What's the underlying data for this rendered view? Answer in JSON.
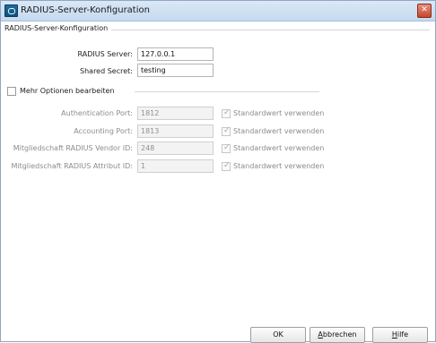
{
  "window": {
    "title": "RADIUS-Server-Konfiguration"
  },
  "group": {
    "label": "RADIUS-Server-Konfiguration"
  },
  "server": {
    "label": "RADIUS Server:",
    "value": "127.0.0.1"
  },
  "secret": {
    "label": "Shared Secret:",
    "value": "testing"
  },
  "more_options": {
    "label": "Mehr Optionen bearbeiten",
    "checked": false
  },
  "advanced": [
    {
      "label": "Authentication Port:",
      "value": "1812",
      "default_label": "Standardwert verwenden",
      "default_checked": true
    },
    {
      "label": "Accounting Port:",
      "value": "1813",
      "default_label": "Standardwert verwenden",
      "default_checked": true
    },
    {
      "label": "Mitgliedschaft RADIUS Vendor ID:",
      "value": "248",
      "default_label": "Standardwert verwenden",
      "default_checked": true
    },
    {
      "label": "Mitgliedschaft RADIUS Attribut ID:",
      "value": "1",
      "default_label": "Standardwert verwenden",
      "default_checked": true
    }
  ],
  "buttons": {
    "ok": "OK",
    "cancel": {
      "underlined": "A",
      "rest": "bbrechen"
    },
    "help": {
      "underlined": "H",
      "rest": "ilfe"
    }
  },
  "colors": {
    "titlebar": "#c5d9ef",
    "close": "#c4472c"
  }
}
